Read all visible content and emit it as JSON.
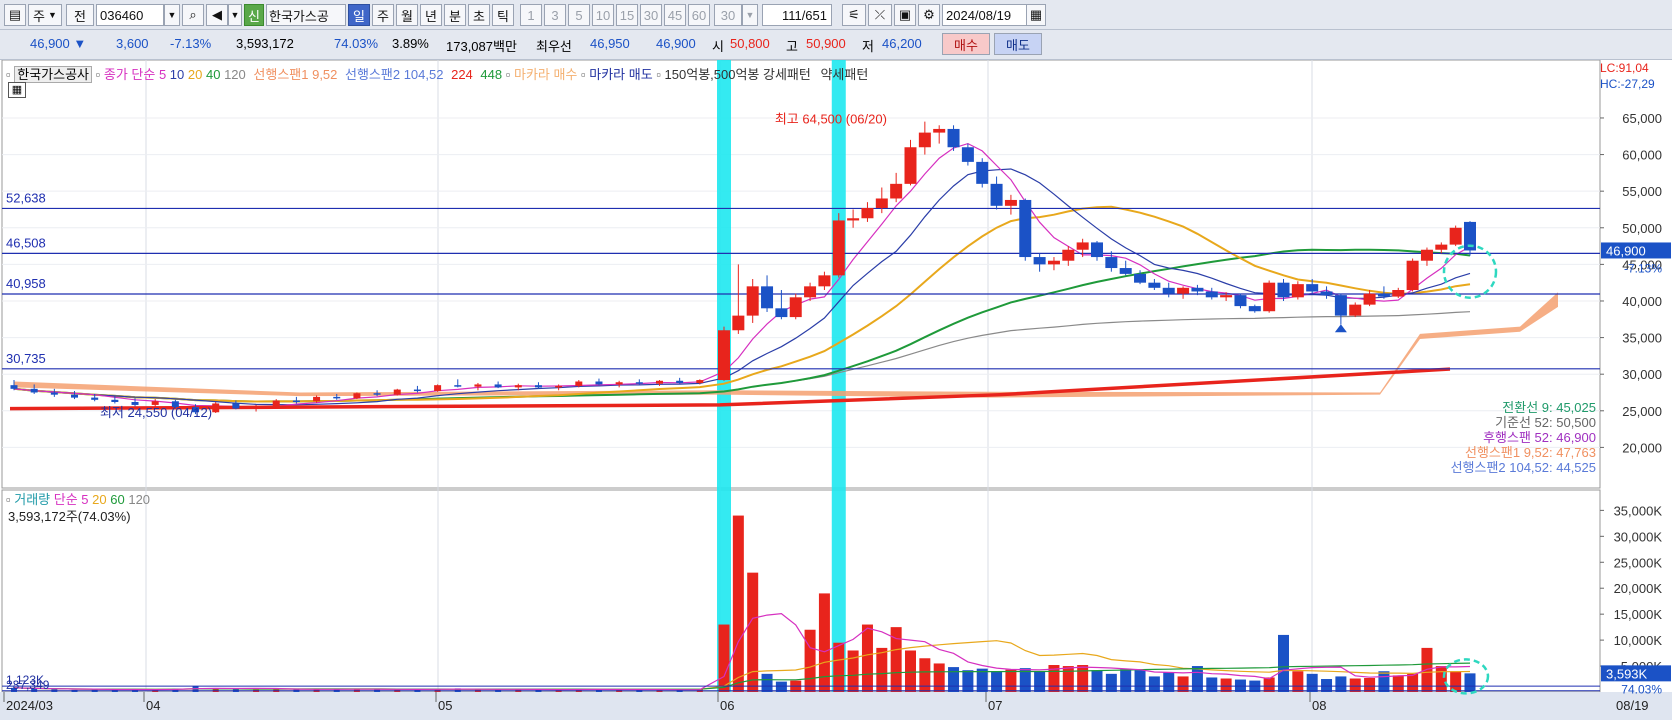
{
  "toolbar": {
    "mode_label": "주",
    "prefix_label": "전",
    "code": "036460",
    "sin_label": "신",
    "name": "한국가스공",
    "periods": [
      "일",
      "주",
      "월",
      "년",
      "분",
      "초",
      "틱"
    ],
    "active_period": "일",
    "minute_options": [
      "1",
      "3",
      "5",
      "10",
      "15",
      "30",
      "45",
      "60"
    ],
    "count_label": "30",
    "page": "111/651",
    "date": "2024/08/19"
  },
  "info": {
    "price": "46,900",
    "change": "3,600",
    "change_pct": "-7.13%",
    "volume": "3,593,172",
    "vol_ratio": "74.03%",
    "turnover": "3.89%",
    "amount": "173,087백만",
    "best_label": "최우선",
    "best_ask": "46,950",
    "best_bid": "46,900",
    "open_label": "시",
    "open": "50,800",
    "high_label": "고",
    "high": "50,900",
    "low_label": "저",
    "low": "46,200",
    "buy_label": "매수",
    "sell_label": "매도"
  },
  "legend": {
    "stock_name": "한국가스공사",
    "ma_label": "종가 단순",
    "ma_periods": [
      "5",
      "10",
      "20",
      "40",
      "120"
    ],
    "span1": "선행스팬1 9,52",
    "span2": "선행스팬2 104,52",
    "n224": "224",
    "n448": "448",
    "macara_buy": "마카라 매수",
    "macara_sell": "마카라 매도",
    "pattern": "150억봉,500억봉 강세패턴",
    "weak": "약세패턴"
  },
  "colors": {
    "up": "#e8241c",
    "down": "#1b52c6",
    "ma5": "#d630c0",
    "ma10": "#2b3ea8",
    "ma20": "#e8a81c",
    "ma40": "#1f9a3a",
    "ma120": "#8a8a8a",
    "span": "#f4a070",
    "hline": "#1f2fb0",
    "cyan": "#1ee8f0"
  },
  "price_axis": [
    "65,000",
    "60,000",
    "55,000",
    "50,000",
    "45,000",
    "40,000",
    "35,000",
    "30,000",
    "25,000",
    "20,000"
  ],
  "lc": "LC:91,04",
  "hc": "HC:-27,29",
  "current_price_tag": "46,900",
  "current_pct_tag": "-7.13%",
  "hlines": [
    {
      "label": "52,638",
      "value": 52638
    },
    {
      "label": "46,508",
      "value": 46508
    },
    {
      "label": "40,958",
      "value": 40958
    },
    {
      "label": "30,735",
      "value": 30735
    }
  ],
  "high_annotation": "최고 64,500 (06/20)",
  "low_annotation": "최저 24,550 (04/12)",
  "ichimoku": [
    {
      "text": "전환선 9: 45,025",
      "color": "#1f9a6a"
    },
    {
      "text": "기준선 52: 50,500",
      "color": "#666666"
    },
    {
      "text": "후행스팬 52: 46,900",
      "color": "#a030c0"
    },
    {
      "text": "선행스팬1 9,52: 47,763",
      "color": "#f09060"
    },
    {
      "text": "선행스팬2 104,52: 44,525",
      "color": "#5a7ad8"
    }
  ],
  "volume_legend": {
    "title": "거래량",
    "ma_label": "단순",
    "periods": [
      "5",
      "20",
      "60",
      "120"
    ]
  },
  "volume_stat": "3,593,172주(74.03%)",
  "volume_axis": [
    "35,000K",
    "30,000K",
    "25,000K",
    "20,000K",
    "15,000K",
    "10,000K",
    "5,000K"
  ],
  "volume_tag": "3,593K",
  "volume_pct_tag": "74.03%",
  "vol_left_labels": [
    "1,123K",
    "237,349"
  ],
  "x_labels": [
    {
      "text": "2024/03",
      "x": 6
    },
    {
      "text": "04",
      "x": 146
    },
    {
      "text": "05",
      "x": 438
    },
    {
      "text": "06",
      "x": 720
    },
    {
      "text": "07",
      "x": 988
    },
    {
      "text": "08",
      "x": 1312
    }
  ],
  "x_right_label": "08/19",
  "chart_data": {
    "type": "candlestick",
    "ylim": [
      15000,
      68000
    ],
    "candles": [
      [
        28500,
        29200,
        27800,
        28000
      ],
      [
        28000,
        28600,
        27300,
        27500
      ],
      [
        27500,
        28000,
        26900,
        27200
      ],
      [
        27200,
        27700,
        26600,
        26800
      ],
      [
        26800,
        27300,
        26300,
        26500
      ],
      [
        26500,
        27000,
        26000,
        26200
      ],
      [
        26200,
        26700,
        25600,
        25800
      ],
      [
        25800,
        26600,
        25500,
        26300
      ],
      [
        26300,
        26500,
        25300,
        25500
      ],
      [
        25500,
        25900,
        24550,
        24800
      ],
      [
        24800,
        26200,
        24700,
        26000
      ],
      [
        26000,
        26400,
        25200,
        25300
      ],
      [
        25300,
        25800,
        24900,
        25600
      ],
      [
        25600,
        26600,
        25500,
        26400
      ],
      [
        26400,
        26900,
        26000,
        26300
      ],
      [
        26300,
        27100,
        26100,
        26900
      ],
      [
        26900,
        27300,
        26500,
        26700
      ],
      [
        26700,
        27500,
        26600,
        27400
      ],
      [
        27400,
        27800,
        27000,
        27200
      ],
      [
        27200,
        28000,
        27100,
        27900
      ],
      [
        27900,
        28400,
        27500,
        27700
      ],
      [
        27700,
        28600,
        27600,
        28500
      ],
      [
        28500,
        29300,
        28200,
        28300
      ],
      [
        28300,
        28800,
        27800,
        28600
      ],
      [
        28600,
        29000,
        28100,
        28200
      ],
      [
        28200,
        28700,
        27800,
        28500
      ],
      [
        28500,
        28900,
        28000,
        28200
      ],
      [
        28200,
        28600,
        27800,
        28400
      ],
      [
        28400,
        29200,
        28200,
        29000
      ],
      [
        29000,
        29400,
        28500,
        28600
      ],
      [
        28600,
        29100,
        28200,
        28900
      ],
      [
        28900,
        29300,
        28500,
        28700
      ],
      [
        28700,
        29200,
        28400,
        29100
      ],
      [
        29100,
        29500,
        28700,
        28800
      ],
      [
        28800,
        29300,
        28600,
        29200
      ],
      [
        29200,
        36500,
        29100,
        36000
      ],
      [
        36000,
        45000,
        35500,
        38000
      ],
      [
        38000,
        43000,
        37000,
        42000
      ],
      [
        42000,
        43500,
        38500,
        39000
      ],
      [
        39000,
        41500,
        37500,
        37800
      ],
      [
        37800,
        41000,
        37500,
        40500
      ],
      [
        40500,
        42500,
        40000,
        42000
      ],
      [
        42000,
        44000,
        41500,
        43500
      ],
      [
        43500,
        52000,
        43200,
        51000
      ],
      [
        51000,
        52500,
        50000,
        51300
      ],
      [
        51300,
        53500,
        50800,
        52700
      ],
      [
        52700,
        55500,
        52000,
        54000
      ],
      [
        54000,
        57500,
        53500,
        56000
      ],
      [
        56000,
        62000,
        55800,
        61000
      ],
      [
        61000,
        64500,
        60000,
        63000
      ],
      [
        63000,
        64000,
        61500,
        63500
      ],
      [
        63500,
        64000,
        60500,
        61000
      ],
      [
        61000,
        61500,
        58500,
        59000
      ],
      [
        59000,
        59500,
        55500,
        56000
      ],
      [
        56000,
        57000,
        52500,
        53000
      ],
      [
        53000,
        54500,
        51800,
        53800
      ],
      [
        53800,
        54000,
        45500,
        46000
      ],
      [
        46000,
        46500,
        44000,
        45000
      ],
      [
        45000,
        46000,
        44200,
        45500
      ],
      [
        45500,
        47500,
        44800,
        47000
      ],
      [
        47000,
        48500,
        46000,
        48000
      ],
      [
        48000,
        48200,
        45500,
        46000
      ],
      [
        46000,
        46800,
        44000,
        44500
      ],
      [
        44500,
        45500,
        43500,
        43700
      ],
      [
        43700,
        44200,
        42300,
        42500
      ],
      [
        42500,
        43000,
        41500,
        41800
      ],
      [
        41800,
        42500,
        40500,
        41000
      ],
      [
        41000,
        42000,
        40300,
        41800
      ],
      [
        41800,
        42200,
        40800,
        41300
      ],
      [
        41300,
        41800,
        40200,
        40500
      ],
      [
        40500,
        41200,
        40000,
        40800
      ],
      [
        40800,
        41000,
        39000,
        39300
      ],
      [
        39300,
        39500,
        38400,
        38600
      ],
      [
        38600,
        42800,
        38400,
        42500
      ],
      [
        42500,
        43000,
        40000,
        40500
      ],
      [
        40500,
        42700,
        40200,
        42300
      ],
      [
        42300,
        43000,
        41000,
        41300
      ],
      [
        41300,
        42000,
        40300,
        40800
      ],
      [
        40800,
        41000,
        36800,
        38000
      ],
      [
        38000,
        39800,
        37800,
        39500
      ],
      [
        39500,
        41500,
        39300,
        41000
      ],
      [
        41000,
        42000,
        40300,
        40600
      ],
      [
        40600,
        41800,
        40400,
        41500
      ],
      [
        41500,
        45800,
        41300,
        45500
      ],
      [
        45500,
        47300,
        44800,
        47000
      ],
      [
        47000,
        48000,
        46500,
        47700
      ],
      [
        47700,
        50300,
        47500,
        50000
      ],
      [
        50800,
        50900,
        46200,
        46900
      ]
    ],
    "volumes_k": [
      800,
      600,
      500,
      400,
      450,
      500,
      550,
      400,
      650,
      1123,
      700,
      500,
      450,
      600,
      500,
      550,
      480,
      520,
      600,
      450,
      500,
      550,
      700,
      450,
      420,
      480,
      500,
      450,
      600,
      480,
      420,
      500,
      380,
      460,
      550,
      13000,
      34000,
      23000,
      3500,
      2000,
      2200,
      12000,
      19000,
      9500,
      8000,
      13000,
      8500,
      12500,
      8000,
      6500,
      5500,
      4800,
      4200,
      4500,
      4000,
      4300,
      4600,
      4000,
      5200,
      5000,
      5200,
      4200,
      3500,
      4400,
      4200,
      3000,
      3800,
      3000,
      5000,
      2800,
      2600,
      2400,
      2200,
      2800,
      11000,
      4000,
      3500,
      2500,
      3000,
      2600,
      2700,
      4000,
      3200,
      3500,
      8500,
      5000,
      4000,
      3593
    ],
    "volume_ylim": [
      0,
      37000
    ]
  }
}
